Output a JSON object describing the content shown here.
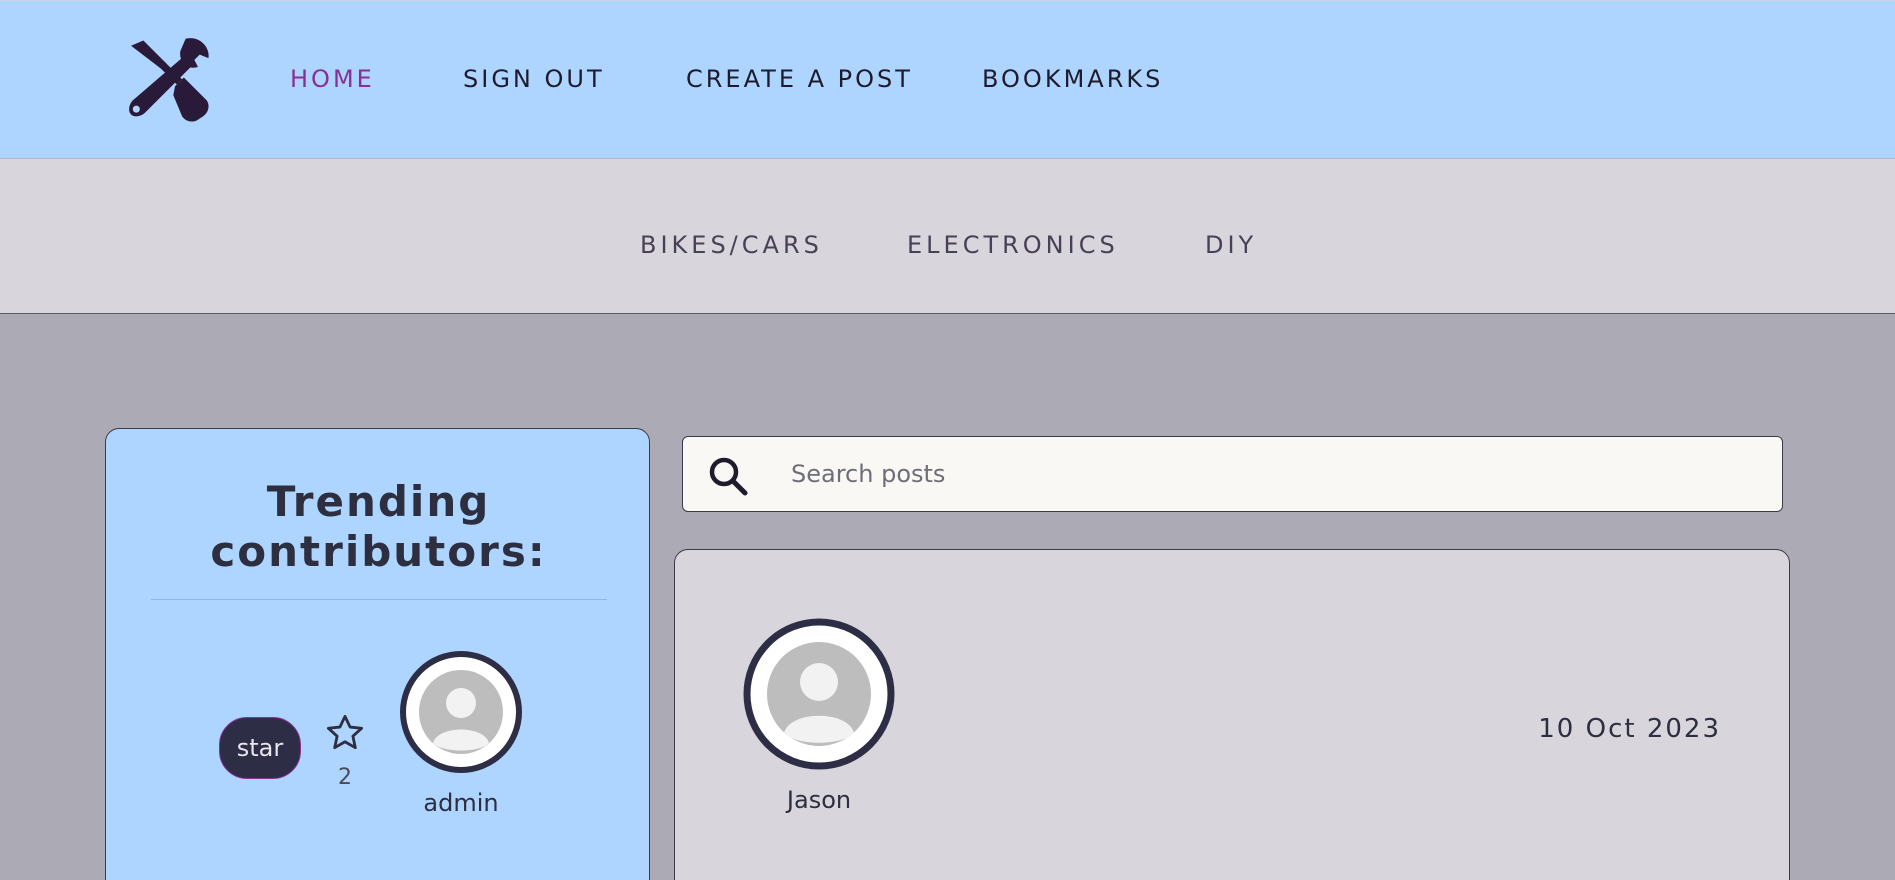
{
  "nav": {
    "items": [
      {
        "label": "HOME",
        "active": true
      },
      {
        "label": "SIGN OUT",
        "active": false
      },
      {
        "label": "CREATE A POST",
        "active": false
      },
      {
        "label": "BOOKMARKS",
        "active": false
      }
    ],
    "logo_icon": "tools-icon"
  },
  "categories": {
    "items": [
      {
        "label": "BIKES/CARS"
      },
      {
        "label": "ELECTRONICS"
      },
      {
        "label": "DIY"
      }
    ]
  },
  "sidebar": {
    "title": "Trending contributors:",
    "contributors": [
      {
        "badge": "star",
        "stars": "2",
        "name": "admin"
      }
    ]
  },
  "search": {
    "placeholder": "Search posts",
    "value": ""
  },
  "post": {
    "author": "Jason",
    "date": "10 Oct 2023"
  },
  "colors": {
    "nav_bg": "#add5ff",
    "category_bg": "#d8d6dc",
    "page_bg": "#acabb5",
    "accent": "#8a2f97",
    "dark": "#2d2e45"
  }
}
